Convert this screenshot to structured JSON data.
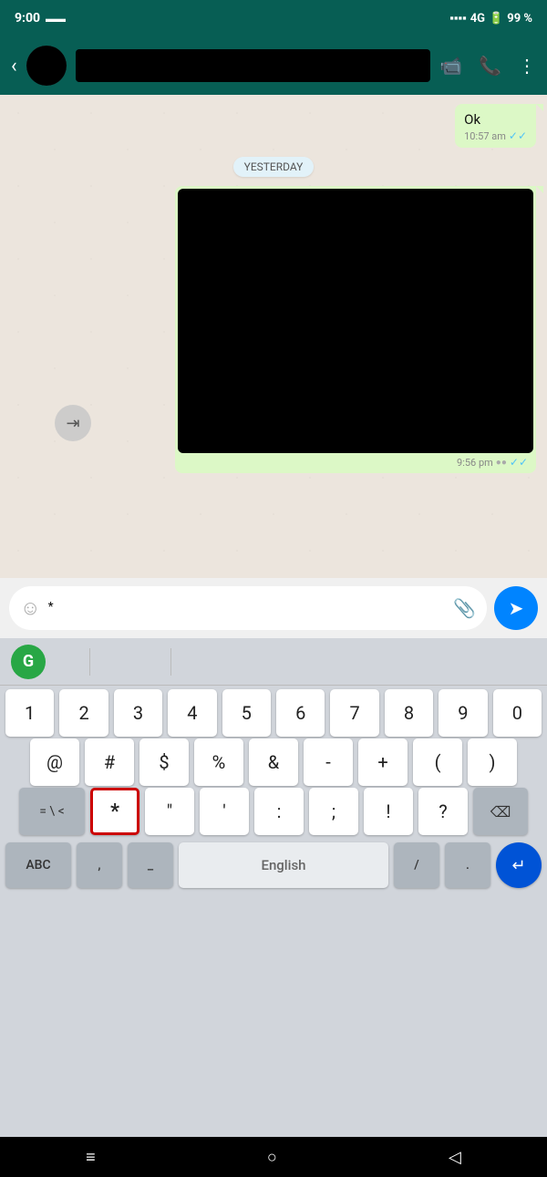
{
  "statusBar": {
    "time": "9:00",
    "signal": "4G",
    "battery": "99 %"
  },
  "header": {
    "contactName": "",
    "backLabel": "‹"
  },
  "messages": [
    {
      "id": "msg1",
      "type": "sent",
      "text": "Ok",
      "time": "10:57 am",
      "checked": true
    }
  ],
  "dateDivider": "YESTERDAY",
  "videoMessage": {
    "time": "9:56 pm",
    "checked": true
  },
  "inputBar": {
    "placeholder": "*",
    "emojiIcon": "☺",
    "attachIcon": "📎",
    "sendIcon": "➤"
  },
  "keyboard": {
    "grammarlyLetter": "G",
    "row1": [
      "1",
      "2",
      "3",
      "4",
      "5",
      "6",
      "7",
      "8",
      "9",
      "0"
    ],
    "row2": [
      "@",
      "#",
      "$",
      "%",
      "&",
      "-",
      "+",
      "(",
      ")"
    ],
    "row3special": "= \\ <",
    "row3keys": [
      "*",
      "\"",
      "'",
      ":",
      ";",
      "!",
      "?"
    ],
    "bottomRow": {
      "abc": "ABC",
      "comma": ",",
      "underscore": "_",
      "space": "English",
      "slash": "/",
      "period": ".",
      "enter": "↵"
    }
  },
  "navBar": {
    "homeIcon": "≡",
    "circleIcon": "○",
    "backIcon": "◁"
  }
}
